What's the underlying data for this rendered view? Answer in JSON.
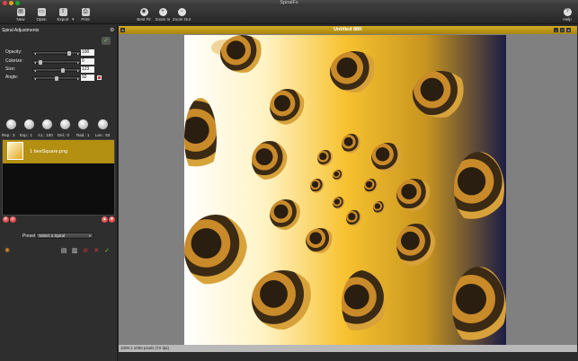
{
  "window": {
    "title": "SpiralFx"
  },
  "toolbar": {
    "new": "New",
    "open": "Open",
    "export": "Export",
    "print": "Print",
    "best_fit": "Best Fit",
    "zoom_in": "Zoom In",
    "zoom_out": "Zoom Out",
    "help": "Help"
  },
  "panel": {
    "title": "Spiral Adjustments",
    "sliders": [
      {
        "label": "Opacity:",
        "value": "100",
        "position": 0.9
      },
      {
        "label": "Colorize:",
        "value": "0",
        "position": 0.0
      },
      {
        "label": "Size:",
        "value": "123",
        "position": 0.7
      },
      {
        "label": "Angle:",
        "value": "92",
        "position": 0.5
      }
    ],
    "knobs": [
      {
        "label": "Rep.: 3"
      },
      {
        "label": "Exp.: 1"
      },
      {
        "label": "A1.: 100"
      },
      {
        "label": "Del.: 0"
      },
      {
        "label": "Rad.: 1"
      },
      {
        "label": "Len.: 93"
      }
    ],
    "list_item": "1 beeSquare.png",
    "preset_label": "Preset:",
    "preset_value": "Select a Spiral"
  },
  "document": {
    "title": "Untitled 88K",
    "status": "1000 x 1000 pixels (72 dpi)"
  },
  "colors": {
    "accent": "#b38f12",
    "toolbar": "#2e2e2e",
    "check": "#7cd23a",
    "delete": "#c41e1e"
  }
}
